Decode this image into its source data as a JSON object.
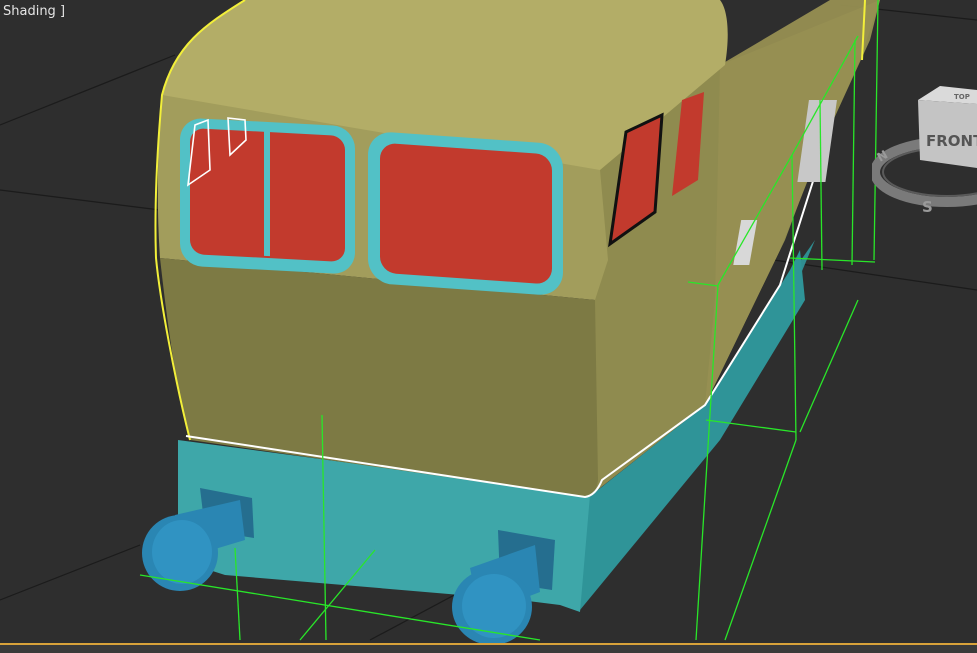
{
  "viewport": {
    "label": "Shading ]",
    "colors": {
      "background": "#2e2e2e",
      "grid": "#1a1a1a",
      "body_top": "#b3ad67",
      "body_front": "#7d7a44",
      "body_side": "#8f8b4f",
      "base": "#3ea7a9",
      "window_frame": "#52c1c6",
      "window_glass": "#c23a2d",
      "buffer": "#2a86b3",
      "selection_yellow": "#f2ef3a",
      "selection_white": "#ffffff",
      "helper_green": "#29e629"
    }
  },
  "viewcube": {
    "face_front": "FRONT",
    "face_top": "TOP",
    "compass_n": "N",
    "compass_s": "S"
  }
}
